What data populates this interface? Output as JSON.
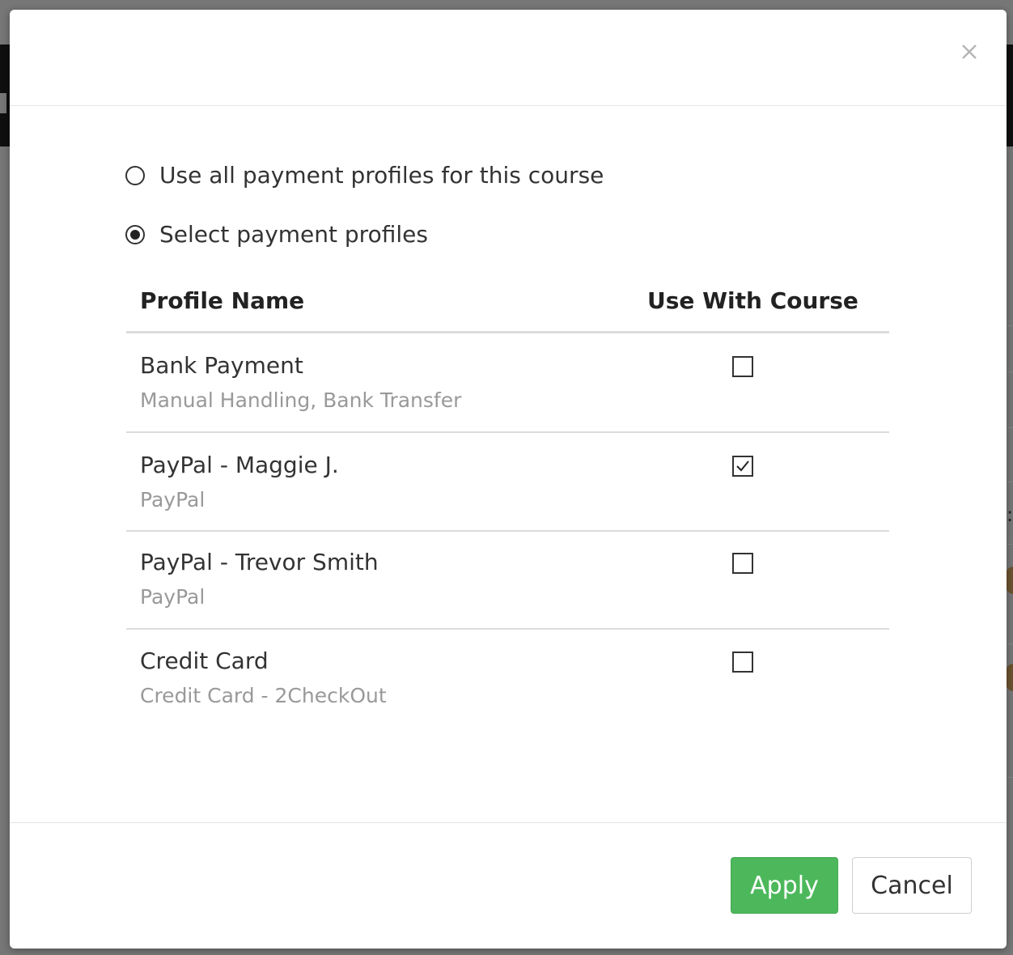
{
  "modal": {
    "close_icon": "close-icon"
  },
  "options": {
    "use_all": {
      "label": "Use all payment profiles for this course",
      "checked": false
    },
    "select": {
      "label": "Select payment profiles",
      "checked": true
    }
  },
  "table": {
    "headers": {
      "name": "Profile Name",
      "use": "Use With Course"
    },
    "rows": [
      {
        "name": "Bank Payment",
        "type": "Manual Handling, Bank Transfer",
        "checked": false
      },
      {
        "name": "PayPal - Maggie J.",
        "type": "PayPal",
        "checked": true
      },
      {
        "name": "PayPal - Trevor Smith",
        "type": "PayPal",
        "checked": false
      },
      {
        "name": "Credit Card",
        "type": "Credit Card - 2CheckOut",
        "checked": false
      }
    ]
  },
  "footer": {
    "apply_label": "Apply",
    "cancel_label": "Cancel"
  },
  "colors": {
    "apply_bg": "#4cb85b",
    "muted_text": "#999999",
    "text": "#333333"
  }
}
